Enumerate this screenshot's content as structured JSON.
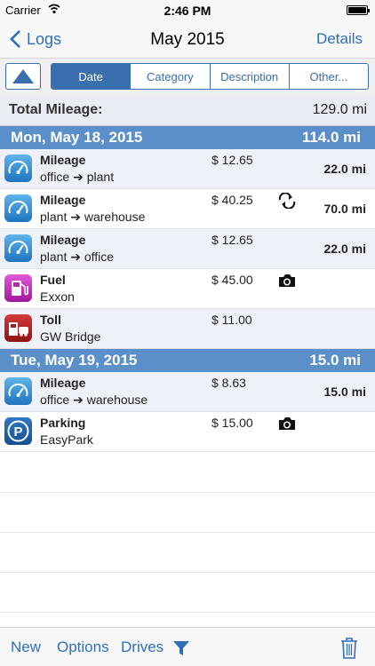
{
  "status_bar": {
    "carrier": "Carrier",
    "time": "2:46 PM"
  },
  "nav": {
    "back_label": "Logs",
    "title": "May 2015",
    "details_label": "Details"
  },
  "segments": [
    "Date",
    "Category",
    "Description",
    "Other..."
  ],
  "active_segment": "Date",
  "total": {
    "label": "Total Mileage:",
    "value": "129.0 mi"
  },
  "days": [
    {
      "date": "Mon, May 18, 2015",
      "mileage": "114.0 mi",
      "entries": [
        {
          "category": "Mileage",
          "description": "office ➔ plant",
          "amount": "$ 12.65",
          "distance": "22.0 mi",
          "icon": "mileage-icon",
          "flag": ""
        },
        {
          "category": "Mileage",
          "description": "plant ➔ warehouse",
          "amount": "$ 40.25",
          "distance": "70.0 mi",
          "icon": "mileage-icon",
          "flag": "round-trip-icon"
        },
        {
          "category": "Mileage",
          "description": "plant ➔ office",
          "amount": "$ 12.65",
          "distance": "22.0 mi",
          "icon": "mileage-icon",
          "flag": ""
        },
        {
          "category": "Fuel",
          "description": "Exxon",
          "amount": "$ 45.00",
          "distance": "",
          "icon": "fuel-icon",
          "flag": "camera-icon"
        },
        {
          "category": "Toll",
          "description": "GW Bridge",
          "amount": "$ 11.00",
          "distance": "",
          "icon": "toll-icon",
          "flag": ""
        }
      ]
    },
    {
      "date": "Tue, May 19, 2015",
      "mileage": "15.0 mi",
      "entries": [
        {
          "category": "Mileage",
          "description": "office ➔ warehouse",
          "amount": "$ 8.63",
          "distance": "15.0 mi",
          "icon": "mileage-icon",
          "flag": ""
        },
        {
          "category": "Parking",
          "description": "EasyPark",
          "amount": "$ 15.00",
          "distance": "",
          "icon": "parking-icon",
          "flag": "camera-icon"
        }
      ]
    }
  ],
  "toolbar": {
    "new_label": "New",
    "options_label": "Options",
    "drives_label": "Drives"
  },
  "colors": {
    "accent": "#2e6fb8",
    "day_header": "#5b8fc9",
    "row_alt": "#eef2f8"
  }
}
